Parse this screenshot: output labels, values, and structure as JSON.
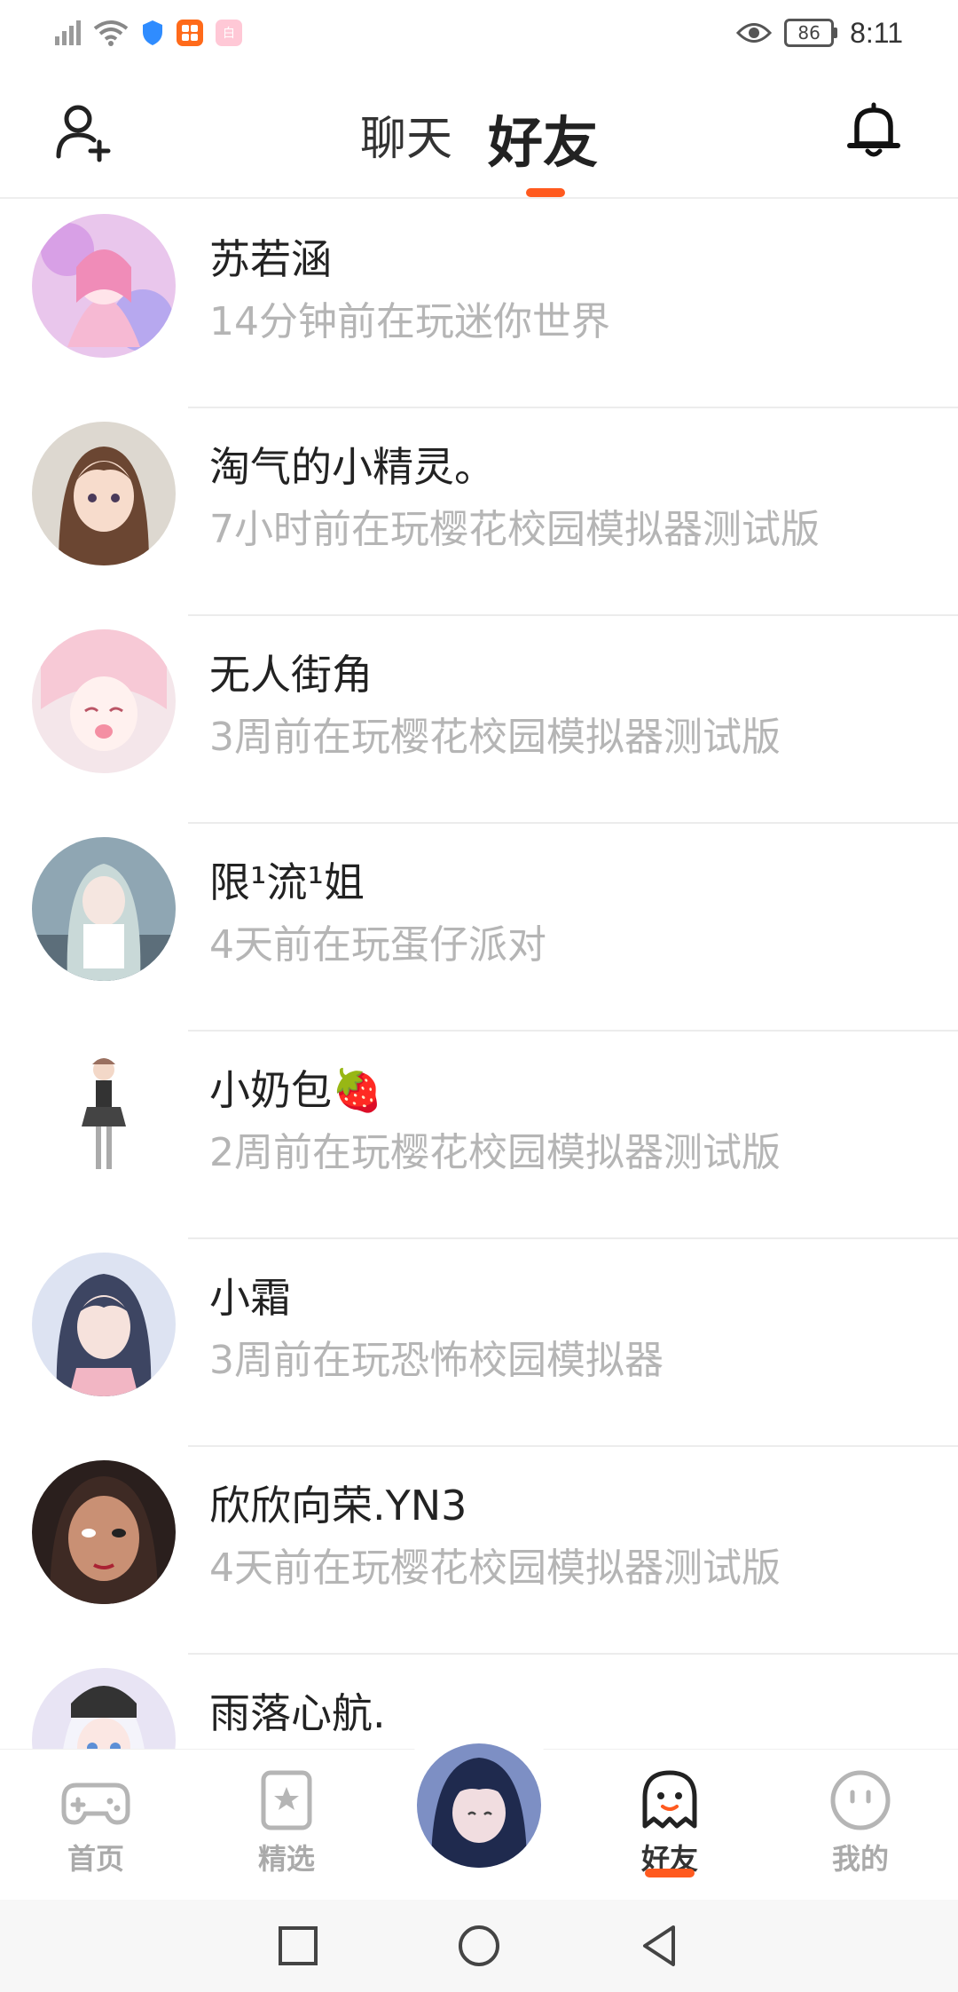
{
  "status_bar": {
    "battery": "86",
    "time": "8:11",
    "app_badge_text": "白"
  },
  "header": {
    "tabs": [
      {
        "label": "聊天",
        "active": false
      },
      {
        "label": "好友",
        "active": true
      }
    ]
  },
  "friends": [
    {
      "name": "苏若涵",
      "status": "14分钟前在玩迷你世界"
    },
    {
      "name": "淘气的小精灵。",
      "status": "7小时前在玩樱花校园模拟器测试版"
    },
    {
      "name": "无人街角",
      "status": "3周前在玩樱花校园模拟器测试版"
    },
    {
      "name": "限¹流¹姐",
      "status": "4天前在玩蛋仔派对"
    },
    {
      "name": "小奶包🍓",
      "status": "2周前在玩樱花校园模拟器测试版"
    },
    {
      "name": "小霜",
      "status": "3周前在玩恐怖校园模拟器"
    },
    {
      "name": "欣欣向荣.YN3",
      "status": "4天前在玩樱花校园模拟器测试版"
    },
    {
      "name": "雨落心航.",
      "status": ""
    }
  ],
  "bottom_nav": [
    {
      "label": "首页",
      "icon": "gamepad-icon",
      "active": false
    },
    {
      "label": "精选",
      "icon": "bookmark-star-icon",
      "active": false
    },
    {
      "label": "好友",
      "icon": "ghost-icon",
      "active": true
    },
    {
      "label": "我的",
      "icon": "smiley-icon",
      "active": false
    }
  ],
  "colors": {
    "accent": "#ff5a1f",
    "name_text": "#222222",
    "status_text": "#b5b5b5"
  }
}
